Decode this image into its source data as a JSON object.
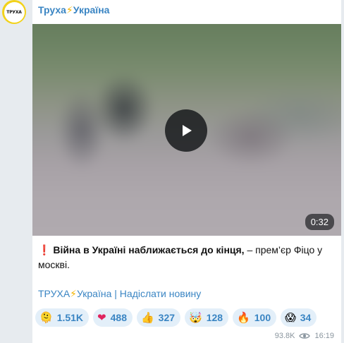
{
  "channel": {
    "avatar_text": "ТРУХА",
    "name_prefix": "Труха",
    "name_bolt": "⚡",
    "name_suffix": "Україна"
  },
  "video": {
    "duration": "0:32"
  },
  "message": {
    "exclamation": "❗",
    "bold_text": "Війна в Україні наближається до кінця,",
    "rest_text": " – прем’єр Фіцо у москві."
  },
  "footer": {
    "link1_prefix": "ТРУХА",
    "link1_bolt": "⚡",
    "link1_suffix": "Україна",
    "separator": " | ",
    "link2": "Надіслати новину"
  },
  "reactions": [
    {
      "emoji": "🫠",
      "count": "1.51K"
    },
    {
      "emoji": "❤",
      "count": "488"
    },
    {
      "emoji": "👍",
      "count": "327"
    },
    {
      "emoji": "🤯",
      "count": "128"
    },
    {
      "emoji": "🔥",
      "count": "100"
    },
    {
      "emoji": "😱",
      "count": "34"
    }
  ],
  "meta": {
    "views": "93.8K",
    "time": "16:19"
  },
  "colors": {
    "accent": "#3a85c3",
    "reaction_bg": "#e3eff9",
    "avatar_ring": "#f2d21a"
  }
}
